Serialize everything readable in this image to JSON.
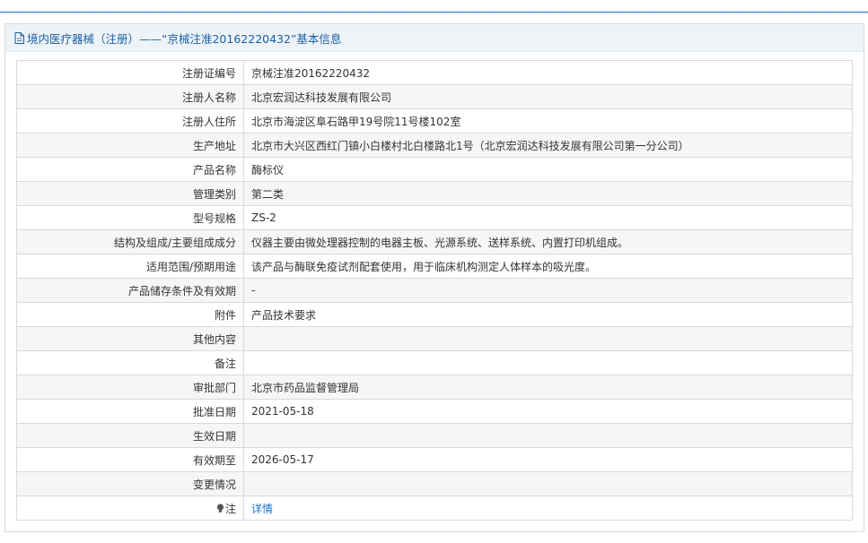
{
  "header": {
    "title": "境内医疗器械（注册）——“京械注准20162220432”基本信息"
  },
  "rows": [
    {
      "label": "注册证编号",
      "value": "京械注准20162220432"
    },
    {
      "label": "注册人名称",
      "value": "北京宏润达科技发展有限公司"
    },
    {
      "label": "注册人住所",
      "value": "北京市海淀区阜石路甲19号院11号楼102室"
    },
    {
      "label": "生产地址",
      "value": "北京市大兴区西红门镇小白楼村北白楼路北1号（北京宏润达科技发展有限公司第一分公司）"
    },
    {
      "label": "产品名称",
      "value": "酶标仪"
    },
    {
      "label": "管理类别",
      "value": "第二类"
    },
    {
      "label": "型号规格",
      "value": "ZS-2"
    },
    {
      "label": "结构及组成/主要组成成分",
      "value": "仪器主要由微处理器控制的电器主板、光源系统、送样系统、内置打印机组成。"
    },
    {
      "label": "适用范围/预期用途",
      "value": "该产品与酶联免疫试剂配套使用，用于临床机构测定人体样本的吸光度。"
    },
    {
      "label": "产品储存条件及有效期",
      "value": "-"
    },
    {
      "label": "附件",
      "value": "产品技术要求"
    },
    {
      "label": "其他内容",
      "value": ""
    },
    {
      "label": "备注",
      "value": ""
    },
    {
      "label": "审批部门",
      "value": "北京市药品监督管理局"
    },
    {
      "label": "批准日期",
      "value": "2021-05-18"
    },
    {
      "label": "生效日期",
      "value": ""
    },
    {
      "label": "有效期至",
      "value": "2026-05-17"
    },
    {
      "label": "变更情况",
      "value": ""
    }
  ],
  "note": {
    "label": "注",
    "icon": "lightbulb-icon",
    "link_text": "详情"
  },
  "colors": {
    "accent": "#1a5fa2",
    "link": "#1a73c9",
    "header_bg": "#eef3f8"
  }
}
